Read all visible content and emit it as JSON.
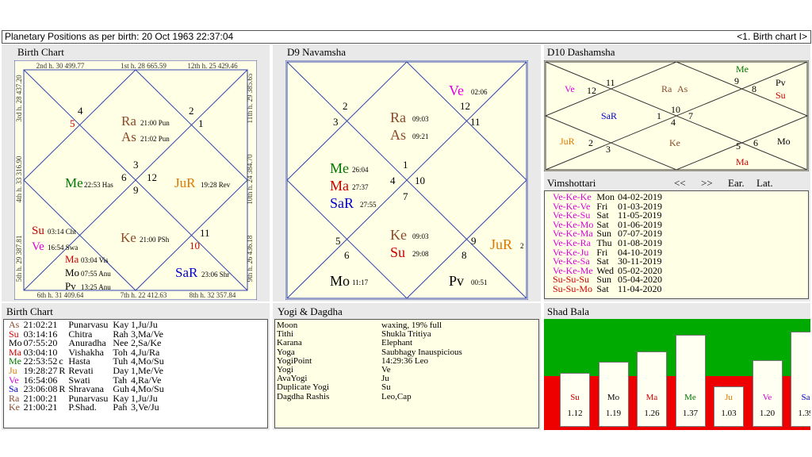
{
  "window": {
    "title": "Planetary Positions as per  birth:  20 Oct 1963  22:37:04",
    "nav": "<1. Birth chart I>"
  },
  "colors": {
    "su": "#cc0000",
    "mo": "#000000",
    "ma": "#cc0000",
    "me": "#007700",
    "ju": "#dd7700",
    "ve": "#dd00dd",
    "sa": "#0000cc",
    "ra": "#8a4a2a",
    "ke": "#8a4a2a",
    "as": "#8a4a2a",
    "pv": "#000000"
  },
  "birth_chart": {
    "title": "Birth Chart",
    "top": [
      "2nd h. 30 499.77",
      "1st h. 28 665.59",
      "12th h. 25 429.46"
    ],
    "bottom": [
      "6th h. 31 409.64",
      "7th h. 22 412.63",
      "8th h. 32 357.84"
    ],
    "left": [
      "3rd h. 28 437.20",
      "4th h. 33 316.90",
      "5th h. 29 387.81"
    ],
    "right": [
      "11th h. 29 385.65",
      "10th h. 24 384.70",
      "9th h. 26 436.18"
    ],
    "houses": [
      "4",
      "5",
      "2",
      "1",
      "3",
      "6",
      "12",
      "9",
      "11",
      "10"
    ],
    "planets": [
      {
        "n": "Ra",
        "d": "21:00 Pun",
        "c": "ra"
      },
      {
        "n": "As",
        "d": "21:02 Pun",
        "c": "as"
      },
      {
        "n": "Me",
        "d": "22:53 Has",
        "c": "me"
      },
      {
        "n": "JuR",
        "d": "19:28 Rev",
        "c": "ju"
      },
      {
        "n": "Ke",
        "d": "21:00 PSh",
        "c": "ke"
      },
      {
        "n": "SaR",
        "d": "23:06 Shr",
        "c": "sa"
      },
      {
        "n": "Su",
        "d": "03:14 Cht",
        "c": "su"
      },
      {
        "n": "Ve",
        "d": "16:54 Swa",
        "c": "ve"
      },
      {
        "n": "Ma",
        "d": "03:04 Vis",
        "c": "ma"
      },
      {
        "n": "Mo",
        "d": "07:55 Anu",
        "c": "mo"
      },
      {
        "n": "Pv",
        "d": "13:25 Anu",
        "c": "pv"
      }
    ]
  },
  "navamsha": {
    "title": "D9 Navamsha",
    "houses": [
      "2",
      "3",
      "12",
      "11",
      "1",
      "4",
      "10",
      "7",
      "5",
      "6",
      "9",
      "8"
    ],
    "planets": [
      {
        "n": "Ve",
        "d": "02:06",
        "c": "ve"
      },
      {
        "n": "Ra",
        "d": "09:03",
        "c": "ra"
      },
      {
        "n": "As",
        "d": "09:21",
        "c": "as"
      },
      {
        "n": "Me",
        "d": "26:04",
        "c": "me"
      },
      {
        "n": "Ma",
        "d": "27:37",
        "c": "ma"
      },
      {
        "n": "SaR",
        "d": "27:55",
        "c": "sa"
      },
      {
        "n": "Ke",
        "d": "09:03",
        "c": "ke"
      },
      {
        "n": "Su",
        "d": "29:08",
        "c": "su"
      },
      {
        "n": "JuR",
        "d": "2",
        "c": "ju"
      },
      {
        "n": "Mo",
        "d": "11:17",
        "c": "mo"
      },
      {
        "n": "Pv",
        "d": "00:51",
        "c": "pv"
      }
    ]
  },
  "dashamsha": {
    "title": "D10 Dashamsha",
    "houses": [
      "11",
      "12",
      "9",
      "8",
      "10",
      "1",
      "7",
      "4",
      "2",
      "3",
      "5",
      "6"
    ],
    "planets": [
      {
        "n": "Me",
        "c": "me"
      },
      {
        "n": "Ve",
        "c": "ve"
      },
      {
        "n": "Ra",
        "c": "ra"
      },
      {
        "n": "As",
        "c": "as"
      },
      {
        "n": "Pv",
        "c": "pv"
      },
      {
        "n": "Su",
        "c": "su"
      },
      {
        "n": "SaR",
        "c": "sa"
      },
      {
        "n": "JuR",
        "c": "ju"
      },
      {
        "n": "Ke",
        "c": "ke"
      },
      {
        "n": "Mo",
        "c": "mo"
      },
      {
        "n": "Ma",
        "c": "ma"
      }
    ]
  },
  "vimshottari": {
    "title": "Vimshottari",
    "prev": "<<",
    "next": ">>",
    "ear": "Ear.",
    "lat": "Lat.",
    "rows": [
      {
        "p": "Ve-Ke-Ke",
        "d": "Mon",
        "dt": "04-02-2019",
        "c": "ve"
      },
      {
        "p": "Ve-Ke-Ve",
        "d": "Fri",
        "dt": "01-03-2019",
        "c": "ve"
      },
      {
        "p": "Ve-Ke-Su",
        "d": "Sat",
        "dt": "11-05-2019",
        "c": "ve"
      },
      {
        "p": "Ve-Ke-Mo",
        "d": "Sat",
        "dt": "01-06-2019",
        "c": "ve"
      },
      {
        "p": "Ve-Ke-Ma",
        "d": "Sun",
        "dt": "07-07-2019",
        "c": "ve"
      },
      {
        "p": "Ve-Ke-Ra",
        "d": "Thu",
        "dt": "01-08-2019",
        "c": "ve"
      },
      {
        "p": "Ve-Ke-Ju",
        "d": "Fri",
        "dt": "04-10-2019",
        "c": "ve"
      },
      {
        "p": "Ve-Ke-Sa",
        "d": "Sat",
        "dt": "30-11-2019",
        "c": "ve"
      },
      {
        "p": "Ve-Ke-Me",
        "d": "Wed",
        "dt": "05-02-2020",
        "c": "ve"
      },
      {
        "p": "Su-Su-Su",
        "d": "Sun",
        "dt": "05-04-2020",
        "c": "su"
      },
      {
        "p": "Su-Su-Mo",
        "d": "Sat",
        "dt": "11-04-2020",
        "c": "su"
      }
    ]
  },
  "birth_table": {
    "title": "Birth Chart",
    "rows": [
      [
        "As",
        "21:02:21",
        "",
        "Punarvasu",
        "Kay",
        "1,Ju/Ju",
        "as"
      ],
      [
        "Su",
        "03:14:16",
        "",
        "Chitra",
        "Rah",
        "3,Ma/Ve",
        "su"
      ],
      [
        "Mo",
        "07:55:20",
        "",
        "Anuradha",
        "Nee",
        "2,Sa/Ke",
        "mo"
      ],
      [
        "Ma",
        "03:04:10",
        "",
        "Vishakha",
        "Toh",
        "4,Ju/Ra",
        "ma"
      ],
      [
        "Me",
        "22:53:52",
        "c",
        "Hasta",
        "Tuh",
        "4,Mo/Su",
        "me"
      ],
      [
        "Ju",
        "19:28:27",
        "R",
        "Revati",
        "Day",
        "1,Me/Ve",
        "ju"
      ],
      [
        "Ve",
        "16:54:06",
        "",
        "Swati",
        "Tah",
        "4,Ra/Ve",
        "ve"
      ],
      [
        "Sa",
        "23:06:08",
        "R",
        "Shravana",
        "Guh",
        "4,Mo/Su",
        "sa"
      ],
      [
        "Ra",
        "21:00:21",
        "",
        "Punarvasu",
        "Kay",
        "1,Ju/Ju",
        "ra"
      ],
      [
        "Ke",
        "21:00:21",
        "",
        "P.Shad.",
        "Pah",
        "3,Ve/Ju",
        "ke"
      ]
    ]
  },
  "yogi": {
    "title": "Yogi & Dagdha",
    "rows": [
      [
        "Moon",
        "waxing, 19% full"
      ],
      [
        "Tithi",
        "Shukla  Tritiya"
      ],
      [
        "Karana",
        "Elephant"
      ],
      [
        "Yoga",
        "Saubhagy Inauspicious"
      ],
      [
        "YogiPoint",
        "14:29:36 Leo"
      ],
      [
        "Yogi",
        "Ve"
      ],
      [
        "AvaYogi",
        "Ju"
      ],
      [
        "Duplicate Yogi",
        "Su"
      ],
      [
        "Dagdha Rashis",
        "Leo,Cap"
      ]
    ]
  },
  "shad_bala": {
    "title": "Shad Bala",
    "bars": [
      {
        "n": "Su",
        "v": "1.12",
        "c": "su"
      },
      {
        "n": "Mo",
        "v": "1.19",
        "c": "mo"
      },
      {
        "n": "Ma",
        "v": "1.26",
        "c": "ma"
      },
      {
        "n": "Me",
        "v": "1.37",
        "c": "me"
      },
      {
        "n": "Ju",
        "v": "1.03",
        "c": "ju"
      },
      {
        "n": "Ve",
        "v": "1.20",
        "c": "ve"
      },
      {
        "n": "Sa",
        "v": "1.39",
        "c": "sa"
      }
    ]
  }
}
